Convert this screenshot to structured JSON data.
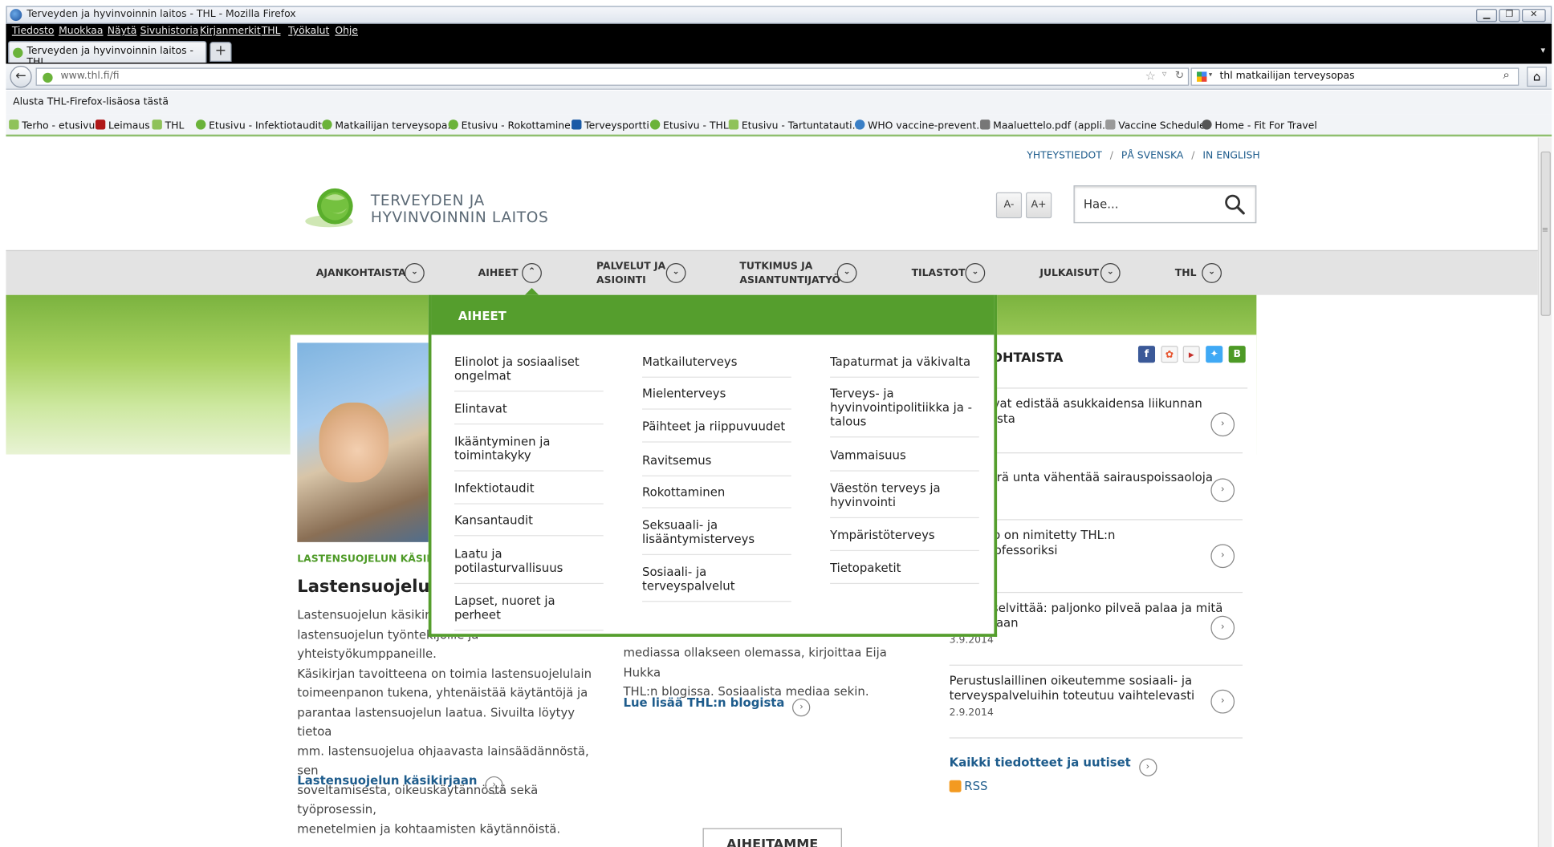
{
  "window": {
    "title": "Terveyden ja hyvinvoinnin laitos - THL - Mozilla Firefox",
    "menu": [
      "Tiedosto",
      "Muokkaa",
      "Näytä",
      "Sivuhistoria",
      "Kirjanmerkit",
      "THL",
      "Työkalut",
      "Ohje"
    ],
    "tab_title": "Terveyden ja hyvinvoinnin laitos - THL",
    "url": "www.thl.fi/fi",
    "search_value": "thl matkailijan terveysopas",
    "addon_text": "Alusta THL-Firefox-lisäosa tästä",
    "bookmarks": [
      "Terho - etusivu",
      "Leimaus",
      "THL",
      "Etusivu - Infektiotaudit...",
      "Matkailijan terveysopa...",
      "Etusivu - Rokottamine...",
      "Terveysportti",
      "Etusivu - THL",
      "Etusivu - Tartuntatauti...",
      "WHO vaccine-prevent...",
      "Maaluettelo.pdf (appli...",
      "Vaccine Schedule",
      "Home - Fit For Travel"
    ]
  },
  "site": {
    "toplinks": [
      "YHTEYSTIEDOT",
      "PÅ SVENSKA",
      "IN ENGLISH"
    ],
    "logo_line1": "TERVEYDEN JA",
    "logo_line2": "HYVINVOINNIN LAITOS",
    "font_decrease": "A-",
    "font_increase": "A+",
    "search_placeholder": "Hae...",
    "nav": [
      {
        "label": "AJANKOHTAISTA"
      },
      {
        "label": "AIHEET"
      },
      {
        "label": "PALVELUT JA ASIOINTI",
        "line1": "PALVELUT JA",
        "line2": "ASIOINTI"
      },
      {
        "label": "TUTKIMUS JA ASIANTUNTIJATYÖ",
        "line1": "TUTKIMUS JA",
        "line2": "ASIANTUNTIJATYÖ"
      },
      {
        "label": "TILASTOT"
      },
      {
        "label": "JULKAISUT"
      },
      {
        "label": "THL"
      }
    ],
    "dropdown": {
      "heading": "AIHEET",
      "col1": [
        "Elinolot ja sosiaaliset ongelmat",
        "Elintavat",
        "Ikääntyminen ja toimintakyky",
        "Infektiotaudit",
        "Kansantaudit",
        "Laatu ja potilasturvallisuus",
        "Lapset, nuoret ja perheet"
      ],
      "col2": [
        "Matkailuterveys",
        "Mielenterveys",
        "Päihteet ja riippuvuudet",
        "Ravitsemus",
        "Rokottaminen",
        "Seksuaali- ja lisääntymisterveys",
        "Sosiaali- ja terveyspalvelut"
      ],
      "col3": [
        "Tapaturmat ja väkivalta",
        "Terveys- ja hyvinvointipolitiikka ja -talous",
        "Vammaisuus",
        "Väestön terveys ja hyvinvointi",
        "Ympäristöterveys",
        "Tietopaketit"
      ]
    },
    "feature": {
      "label": "LASTENSUOJELUN KÄSIKI",
      "title": "Lastensuojelun k",
      "body_lines": [
        "Lastensuojelun käsikirja",
        "lastensuojelun työntekijöille ja yhteistyökumppaneille.",
        "Käsikirjan tavoitteena on toimia lastensuojelulain",
        "toimeenpanon tukena, yhtenäistää käytäntöjä ja",
        "parantaa lastensuojelun laatua. Sivuilta löytyy tietoa",
        "mm. lastensuojelua ohjaavasta lainsäädännöstä, sen",
        "soveltamisesta, oikeuskäytännöstä sekä työprosessin,",
        "menetelmien ja kohtaamisten käytännöistä."
      ],
      "link": "Lastensuojelun käsikirjaan"
    },
    "blog": {
      "body_lines": [
        "mediassa ollakseen olemassa, kirjoittaa Eija Hukka",
        "THL:n blogissa. Sosiaalista mediaa sekin."
      ],
      "link": "Lue lisää THL:n blogista"
    },
    "news": {
      "heading": "KOHTAISTA",
      "items": [
        {
          "text": "oivat edistää asukkaidensa liikunnan mista",
          "date": ""
        },
        {
          "text": "äärä unta vähentää sairauspoissaoloja",
          "date": ""
        },
        {
          "text": "nio on nimitetty THL:n professoriksi",
          "date": ""
        },
        {
          "text": "s selvittää: paljonko pilveä palaa ja mitä ellaan",
          "date": "3.9.2014"
        },
        {
          "text": "Perustuslaillinen oikeutemme sosiaali- ja terveyspalveluihin toteutuu vaihtelevasti",
          "date": "2.9.2014"
        }
      ],
      "all_link": "Kaikki tiedotteet ja uutiset",
      "rss": "RSS"
    },
    "social": [
      "f",
      "",
      "",
      "",
      "B"
    ],
    "bottom_button": "AIHEITAMME"
  },
  "colors": {
    "brand_green": "#559e2d",
    "link_blue": "#1e5c8c"
  }
}
